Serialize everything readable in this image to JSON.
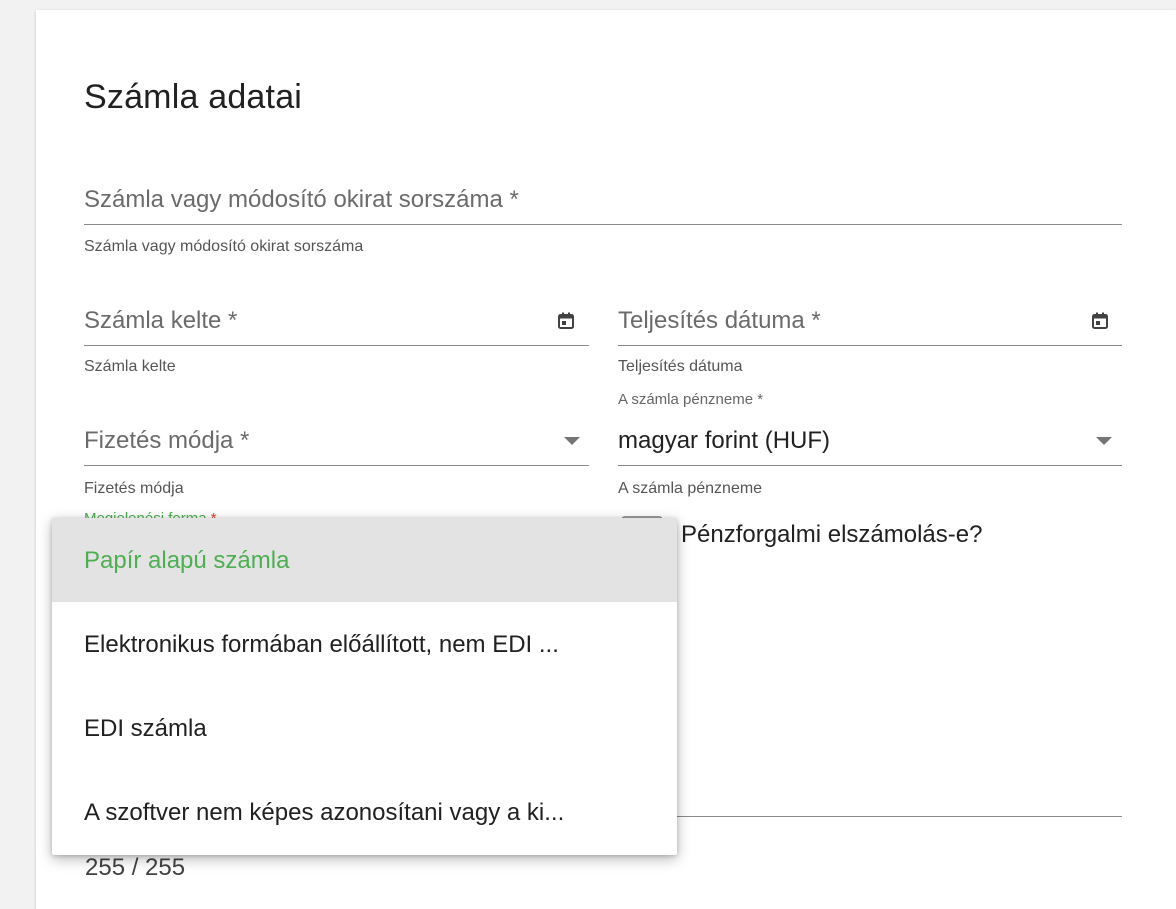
{
  "form": {
    "title": "Számla adatai",
    "invoice_number": {
      "placeholder": "Számla vagy módosító okirat sorszáma *",
      "hint": "Számla vagy módosító okirat sorszáma"
    },
    "invoice_date": {
      "placeholder": "Számla kelte *",
      "hint": "Számla kelte",
      "icon": "calendar-icon"
    },
    "delivery_date": {
      "placeholder": "Teljesítés dátuma *",
      "hint": "Teljesítés dátuma",
      "icon": "calendar-icon"
    },
    "payment_method": {
      "placeholder": "Fizetés módja *",
      "hint": "Fizetés módja",
      "icon": "caret-down-icon"
    },
    "currency": {
      "label": "A számla pénzneme *",
      "value": "magyar forint (HUF)",
      "hint": "A számla pénzneme",
      "icon": "caret-down-icon"
    },
    "appearance": {
      "label": "Megjelenési forma",
      "required_mark": "*"
    },
    "cash_accounting": {
      "label": "Pénzforgalmi elszámolás-e?",
      "checked": false
    },
    "counter": "255 / 255"
  },
  "dropdown": {
    "options": [
      "Papír alapú számla",
      "Elektronikus formában előállított, nem EDI ...",
      "EDI számla",
      "A szoftver nem képes azonosítani vagy a ki..."
    ],
    "selected_index": 0
  },
  "colors": {
    "accent_green": "#4caf50",
    "required_red": "#e53935",
    "selected_bg": "#e3e3e3"
  }
}
